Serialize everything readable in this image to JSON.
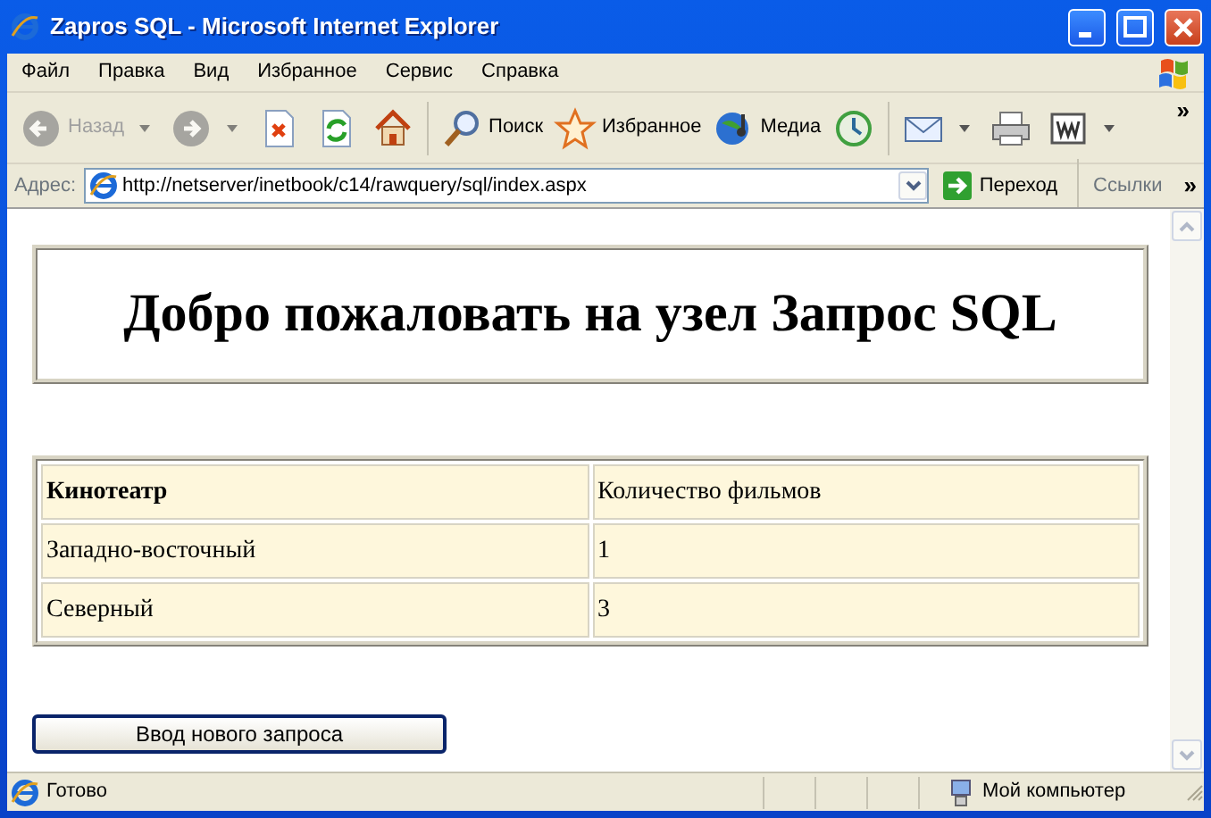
{
  "window": {
    "title": "Zapros SQL - Microsoft Internet Explorer"
  },
  "menu": [
    {
      "label": "Файл"
    },
    {
      "label": "Правка"
    },
    {
      "label": "Вид"
    },
    {
      "label": "Избранное"
    },
    {
      "label": "Сервис"
    },
    {
      "label": "Справка"
    }
  ],
  "toolbar": [
    {
      "kind": "back",
      "label": "Назад",
      "disabled": true,
      "dropdown": true
    },
    {
      "kind": "forward",
      "disabled": true,
      "dropdown": true
    },
    {
      "kind": "stop",
      "disabled": false,
      "dropdown": false
    },
    {
      "kind": "refresh",
      "disabled": false,
      "dropdown": false
    },
    {
      "kind": "home",
      "disabled": false,
      "dropdown": false
    },
    {
      "kind": "separator"
    },
    {
      "kind": "search",
      "label": "Поиск",
      "disabled": false,
      "dropdown": false
    },
    {
      "kind": "favorites",
      "label": "Избранное",
      "disabled": false,
      "dropdown": false
    },
    {
      "kind": "media",
      "label": "Медиа",
      "disabled": false,
      "dropdown": false
    },
    {
      "kind": "history",
      "disabled": false,
      "dropdown": false
    },
    {
      "kind": "separator"
    },
    {
      "kind": "mail",
      "disabled": false,
      "dropdown": true
    },
    {
      "kind": "print",
      "disabled": false,
      "dropdown": false
    },
    {
      "kind": "edit",
      "disabled": false,
      "dropdown": true
    }
  ],
  "toolbar_overflow": "»",
  "address_bar": {
    "label": "Адрес:",
    "url": "http://netserver/inetbook/c14/rawquery/sql/index.aspx",
    "go_label": "Переход",
    "links_label": "Ссылки",
    "overflow": "»"
  },
  "page": {
    "heading": "Добро пожаловать на узел Запрос SQL",
    "table": {
      "columns": [
        {
          "label": "Кинотеатр",
          "bold": true
        },
        {
          "label": "Количество фильмов",
          "bold": false
        }
      ],
      "rows": [
        [
          "Западно-восточный",
          "1"
        ],
        [
          "Северный",
          "3"
        ]
      ]
    },
    "button": "Ввод нового запроса"
  },
  "status_bar": {
    "text": "Готово",
    "zone": "Мой компьютер"
  }
}
